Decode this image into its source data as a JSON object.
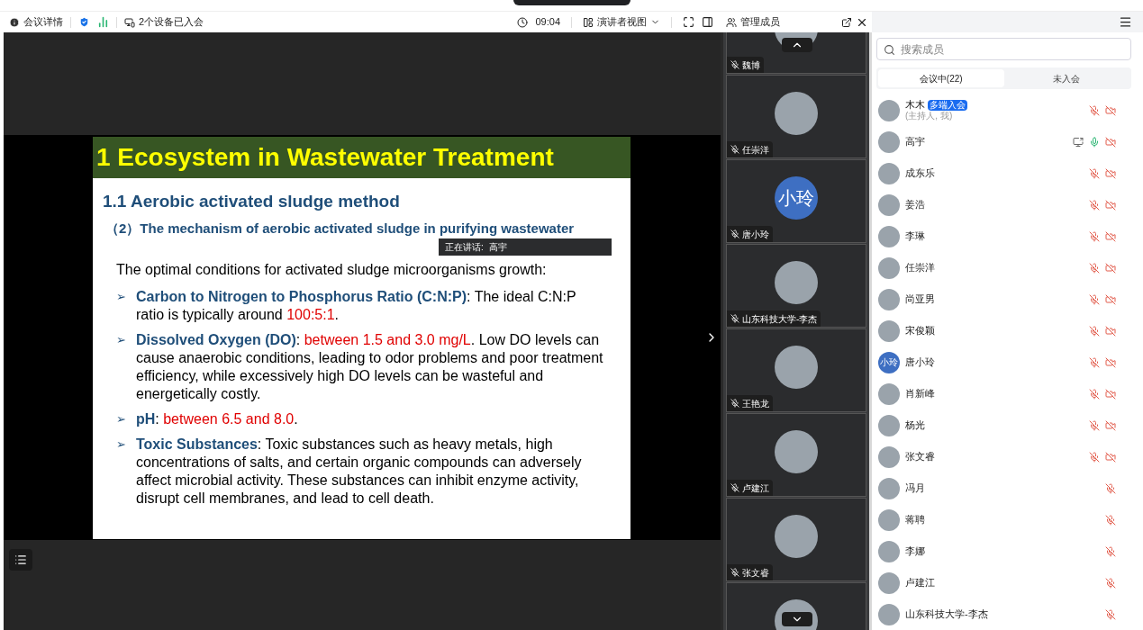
{
  "toolbar": {
    "meeting_info": "会议详情",
    "devices": "2个设备已入会",
    "time": "09:04",
    "view": "演讲者视图"
  },
  "slide": {
    "title": "1 Ecosystem in Wastewater Treatment",
    "heading": "1.1 Aerobic activated sludge method",
    "subheading": "（2）The mechanism of aerobic activated sludge in purifying wastewater",
    "intro": "The optimal conditions for activated sludge microorganisms growth:",
    "bullets": [
      {
        "marker": "➢",
        "segments": [
          {
            "kind": "term",
            "text": "Carbon to Nitrogen to Phosphorus Ratio (C:N:P)"
          },
          {
            "kind": "text",
            "text": ": The ideal C:N:P ratio is typically around "
          },
          {
            "kind": "value",
            "text": "100:5:1"
          },
          {
            "kind": "text",
            "text": "."
          }
        ]
      },
      {
        "marker": "➢",
        "segments": [
          {
            "kind": "term",
            "text": "Dissolved Oxygen (DO)"
          },
          {
            "kind": "text",
            "text": ": "
          },
          {
            "kind": "value",
            "text": "between 1.5 and 3.0 mg/L"
          },
          {
            "kind": "text",
            "text": ". Low DO levels can cause anaerobic conditions, leading to odor problems and poor treatment efficiency, while excessively high DO levels can be wasteful and energetically costly."
          }
        ]
      },
      {
        "marker": "➢",
        "segments": [
          {
            "kind": "term",
            "text": "pH"
          },
          {
            "kind": "text",
            "text": ": "
          },
          {
            "kind": "value",
            "text": "between 6.5 and 8.0"
          },
          {
            "kind": "text",
            "text": "."
          }
        ]
      },
      {
        "marker": "➢",
        "segments": [
          {
            "kind": "term",
            "text": "Toxic Substances"
          },
          {
            "kind": "text",
            "text": ": Toxic substances such as heavy metals, high concentrations of salts, and certain organic compounds can adversely affect microbial activity. These substances can inhibit enzyme activity, disrupt cell membranes, and lead to cell death."
          }
        ]
      }
    ]
  },
  "speaker": {
    "label": "正在讲话:",
    "name": "高宇"
  },
  "video_tiles": [
    {
      "name": "魏博",
      "avatar": {
        "kind": "photo"
      }
    },
    {
      "name": "任崇洋",
      "avatar": {
        "kind": "photo"
      }
    },
    {
      "name": "唐小玲",
      "avatar": {
        "kind": "initials",
        "text": "小玲"
      }
    },
    {
      "name": "山东科技大学-李杰",
      "avatar": {
        "kind": "photo"
      }
    },
    {
      "name": "王艳龙",
      "avatar": {
        "kind": "photo"
      }
    },
    {
      "name": "卢建江",
      "avatar": {
        "kind": "photo"
      }
    },
    {
      "name": "张文睿",
      "avatar": {
        "kind": "photo"
      }
    },
    {
      "avatar": {
        "kind": "photo"
      }
    }
  ],
  "panel": {
    "title": "管理成员",
    "search": {
      "placeholder": "搜索成员"
    },
    "tabs": [
      {
        "label": "会议中(22)",
        "selected": true
      },
      {
        "label": "未入会",
        "selected": false
      }
    ],
    "members": [
      {
        "name": "木木",
        "badge": "多端入会",
        "note": "(主持人, 我)",
        "avatar": {
          "kind": "photo"
        },
        "mic_on": false,
        "camera_off": true
      },
      {
        "name": "高宇",
        "avatar": {
          "kind": "photo"
        },
        "sharing": true,
        "mic_on": true,
        "camera_off": true
      },
      {
        "name": "成东乐",
        "avatar": {
          "kind": "photo"
        },
        "mic_on": false,
        "camera_off": true
      },
      {
        "name": "姜浩",
        "avatar": {
          "kind": "photo"
        },
        "mic_on": false,
        "camera_off": true
      },
      {
        "name": "李琳",
        "avatar": {
          "kind": "photo"
        },
        "mic_on": false,
        "camera_off": true
      },
      {
        "name": "任崇洋",
        "avatar": {
          "kind": "photo"
        },
        "mic_on": false,
        "camera_off": true
      },
      {
        "name": "尚亚男",
        "avatar": {
          "kind": "photo"
        },
        "mic_on": false,
        "camera_off": true
      },
      {
        "name": "宋俊颖",
        "avatar": {
          "kind": "photo"
        },
        "mic_on": false,
        "camera_off": true
      },
      {
        "name": "唐小玲",
        "avatar": {
          "kind": "initials",
          "text": "小玲"
        },
        "mic_on": false,
        "camera_off": true
      },
      {
        "name": "肖新峰",
        "avatar": {
          "kind": "photo"
        },
        "mic_on": false,
        "camera_off": true
      },
      {
        "name": "杨光",
        "avatar": {
          "kind": "photo"
        },
        "mic_on": false,
        "camera_off": true
      },
      {
        "name": "张文睿",
        "avatar": {
          "kind": "photo"
        },
        "mic_on": false,
        "camera_off": true
      },
      {
        "name": "冯月",
        "avatar": {
          "kind": "photo"
        },
        "mic_on": false
      },
      {
        "name": "蒋聘",
        "avatar": {
          "kind": "photo"
        },
        "mic_on": false
      },
      {
        "name": "李娜",
        "avatar": {
          "kind": "photo"
        },
        "mic_on": false
      },
      {
        "name": "卢建江",
        "avatar": {
          "kind": "photo"
        },
        "mic_on": false
      },
      {
        "name": "山东科技大学-李杰",
        "avatar": {
          "kind": "photo"
        },
        "mic_on": false
      }
    ]
  }
}
